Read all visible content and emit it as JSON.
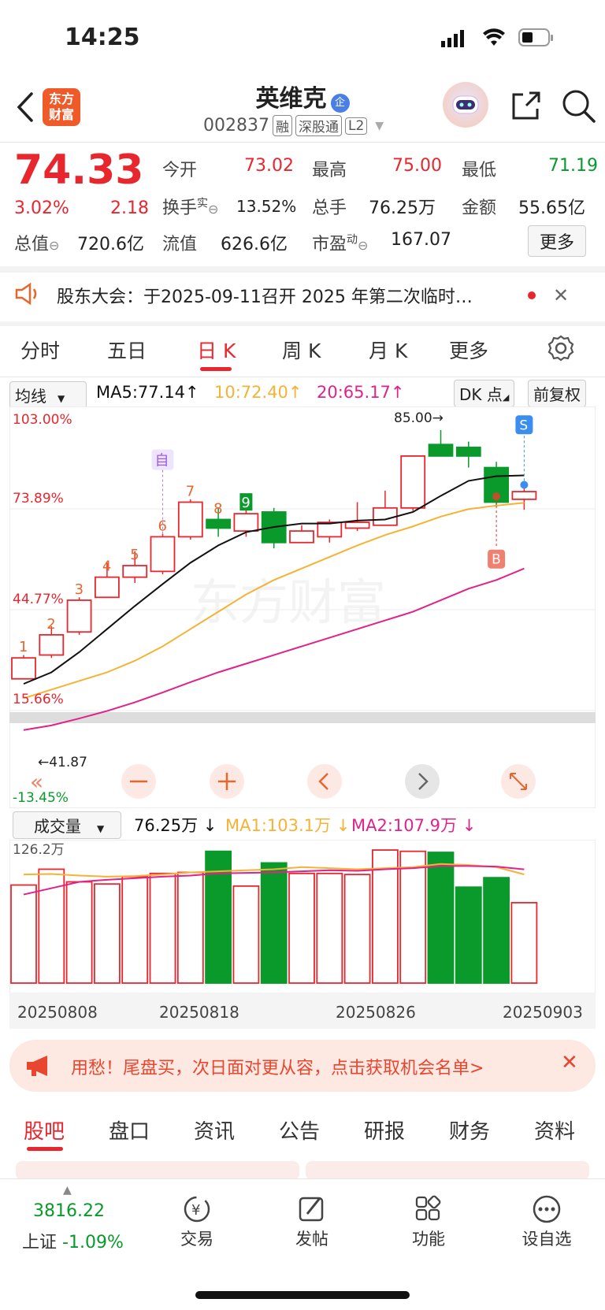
{
  "status": {
    "time": "14:25"
  },
  "header": {
    "title": "英维克",
    "enterprise_badge": "企",
    "code": "002837",
    "tags": [
      "融",
      "深股通",
      "L2"
    ],
    "logo_text": "东方\n财富"
  },
  "quote": {
    "price": "74.33",
    "change_pct": "3.02%",
    "change": "2.18",
    "open_label": "今开",
    "open": "73.02",
    "high_label": "最高",
    "high": "75.00",
    "low_label": "最低",
    "low": "71.19",
    "turnover_label": "换手",
    "turnover_sup": "实",
    "turnover": "13.52%",
    "volume_label": "总手",
    "volume": "76.25万",
    "amount_label": "金额",
    "amount": "55.65亿",
    "mktcap_label": "总值",
    "mktcap": "720.6亿",
    "float_label": "流值",
    "float": "626.6亿",
    "pe_label": "市盈",
    "pe_sup": "动",
    "pe": "167.07",
    "more_button": "更多"
  },
  "notice": {
    "text": "股东大会：于2025-09-11召开 2025 年第二次临时…"
  },
  "period_tabs": [
    "分时",
    "五日",
    "日 K",
    "周 K",
    "月 K",
    "更多"
  ],
  "active_period": "日 K",
  "chart_toolbar": {
    "ma_select": "均线",
    "ma5": "MA5:77.14",
    "ma10": "10:72.40",
    "ma20": "20:65.17",
    "dk_button": "DK 点",
    "adjust_button": "前复权"
  },
  "chart_labels": {
    "y_top": "103.00%",
    "y_mid1": "73.89%",
    "y_mid2": "44.77%",
    "y_mid3": "15.66%",
    "y_bot": "-13.45%",
    "high_mark": "85.00→",
    "low_mark": "←41.87",
    "signal_zi": "自",
    "signal_s": "S",
    "signal_b": "B",
    "watermark": "东方财富"
  },
  "volume_toolbar": {
    "select": "成交量",
    "vol": "76.25万",
    "ma1": "MA1:103.1万",
    "ma2": "MA2:107.9万",
    "max": "126.2万"
  },
  "x_dates": [
    "20250808",
    "20250818",
    "20250826",
    "20250903"
  ],
  "promo": {
    "text": "用愁！尾盘买，次日面对更从容，点击获取机会名单>"
  },
  "content_tabs": [
    "股吧",
    "盘口",
    "资讯",
    "公告",
    "研报",
    "财务",
    "资料"
  ],
  "bottom_nav": {
    "index_value": "3816.22",
    "index_name": "上证",
    "index_change": "-1.09%",
    "items": [
      "交易",
      "发帖",
      "功能",
      "设自选"
    ]
  },
  "colors": {
    "up": "#e8262e",
    "down": "#0a9a2c",
    "ma5": "#111111",
    "ma10": "#f5b335",
    "ma20": "#e0228a",
    "brand": "#f05a28"
  },
  "chart_data": {
    "type": "candlestick",
    "candles": [
      {
        "o": 41.87,
        "c": 45.5,
        "h": 46.0,
        "l": 41.87,
        "seq": "1"
      },
      {
        "o": 46.0,
        "c": 49.5,
        "h": 51.0,
        "l": 45.5,
        "seq": "2"
      },
      {
        "o": 50.0,
        "c": 55.5,
        "h": 56.0,
        "l": 49.5,
        "seq": "3"
      },
      {
        "o": 56.0,
        "c": 59.5,
        "h": 62.0,
        "l": 56.0,
        "seq": "4"
      },
      {
        "o": 59.5,
        "c": 61.5,
        "h": 64.0,
        "l": 58.5,
        "seq": "5"
      },
      {
        "o": 60.5,
        "c": 66.5,
        "h": 67.0,
        "l": 60.0,
        "seq": "6"
      },
      {
        "o": 66.5,
        "c": 72.5,
        "h": 73.0,
        "l": 66.0,
        "seq": "7"
      },
      {
        "o": 69.5,
        "c": 68.0,
        "h": 71.5,
        "l": 66.5,
        "seq": "8"
      },
      {
        "o": 67.5,
        "c": 70.5,
        "h": 71.5,
        "l": 66.5,
        "seq": "9"
      },
      {
        "o": 70.8,
        "c": 65.5,
        "h": 71.5,
        "l": 64.5
      },
      {
        "o": 65.5,
        "c": 67.5,
        "h": 68.5,
        "l": 65.5
      },
      {
        "o": 66.5,
        "c": 69.0,
        "h": 69.5,
        "l": 65.5
      },
      {
        "o": 68.0,
        "c": 69.0,
        "h": 72.5,
        "l": 67.5
      },
      {
        "o": 68.5,
        "c": 71.5,
        "h": 74.5,
        "l": 68.5
      },
      {
        "o": 71.5,
        "c": 80.5,
        "h": 80.5,
        "l": 71.0
      },
      {
        "o": 82.5,
        "c": 80.5,
        "h": 85.0,
        "l": 80.5
      },
      {
        "o": 82.0,
        "c": 80.5,
        "h": 83.0,
        "l": 78.5
      },
      {
        "o": 78.5,
        "c": 72.5,
        "h": 79.5,
        "l": 72.0
      },
      {
        "o": 73.0,
        "c": 74.33,
        "h": 75.0,
        "l": 71.19
      }
    ],
    "ma5": [
      41.0,
      43.0,
      46.5,
      50.5,
      54.5,
      58.3,
      62.0,
      65.0,
      67.3,
      68.2,
      68.8,
      68.8,
      69.3,
      69.5,
      70.8,
      73.6,
      76.2,
      77.0,
      77.14
    ],
    "ma10": [
      38.5,
      40.0,
      41.5,
      43.0,
      45.0,
      47.5,
      50.5,
      53.5,
      56.5,
      59.0,
      61.0,
      63.0,
      65.0,
      66.8,
      68.3,
      70.0,
      71.3,
      71.9,
      72.4
    ],
    "ma20": [
      33.0,
      33.8,
      35.0,
      36.3,
      37.8,
      39.5,
      41.3,
      43.0,
      44.5,
      46.0,
      47.5,
      49.0,
      50.5,
      52.0,
      53.5,
      55.5,
      57.5,
      59.0,
      61.0
    ],
    "volume": [
      93,
      108,
      96,
      94,
      101,
      104,
      105,
      125,
      92,
      114,
      104,
      104,
      103,
      126.2,
      125,
      124,
      91,
      100,
      76.25
    ],
    "vol_ma1": [
      103,
      103.5,
      102,
      101,
      101.5,
      103,
      105,
      106,
      107,
      108,
      110,
      109,
      108,
      109,
      110,
      113,
      112,
      110,
      103.1
    ],
    "vol_ma2": [
      84,
      90,
      96,
      98,
      99.5,
      101,
      102,
      104,
      104.5,
      105,
      106,
      107,
      106.5,
      108,
      109,
      111,
      111,
      110.5,
      107.9
    ],
    "ylim": [
      -13.45,
      103.0
    ],
    "x_ticks": [
      "20250808",
      "20250818",
      "20250826",
      "20250903"
    ]
  }
}
